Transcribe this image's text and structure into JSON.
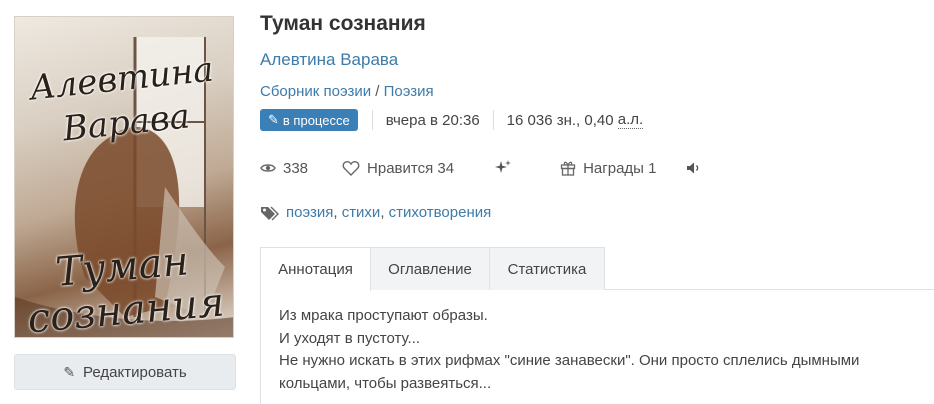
{
  "cover": {
    "author_text": "Алевтина Варава",
    "title_text": "Туман сознания"
  },
  "edit_button": {
    "label": "Редактировать",
    "icon": "pencil-icon"
  },
  "book": {
    "title": "Туман сознания",
    "author": "Алевтина Варава",
    "collection": "Сборник поэзии",
    "separator": "/",
    "genre": "Поэзия"
  },
  "meta": {
    "status": "в процессе",
    "updated": "вчера в 20:36",
    "size": "16 036 зн., 0,40",
    "size_unit": "а.л."
  },
  "stats": {
    "views": "338",
    "likes_label": "Нравится 34",
    "awards_label": "Награды 1"
  },
  "tags": [
    "поэзия",
    "стихи",
    "стихотворения"
  ],
  "tabs": [
    {
      "label": "Аннотация",
      "active": true
    },
    {
      "label": "Оглавление",
      "active": false
    },
    {
      "label": "Статистика",
      "active": false
    }
  ],
  "annotation": [
    "Из мрака проступают образы.",
    "И уходят в пустоту...",
    "Не нужно искать в этих рифмах \"синие занавески\". Они просто сплелись дымными",
    "кольцами, чтобы развеяться..."
  ],
  "colors": {
    "link": "#3d7ba8",
    "badge": "#3a7fb5"
  }
}
